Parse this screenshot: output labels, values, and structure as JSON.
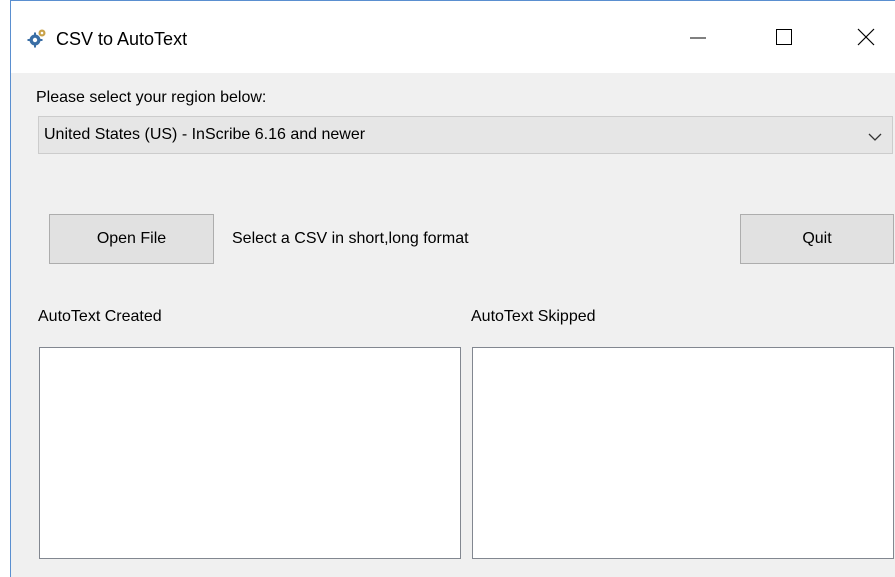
{
  "window": {
    "title": "CSV to AutoText",
    "icons": {
      "app": "gear-icon",
      "minimize": "minimize-icon",
      "maximize": "maximize-icon",
      "close": "close-icon"
    },
    "accent_border_color": "#5a8fd0"
  },
  "region": {
    "label": "Please select your region below:",
    "selected": "United States (US) - InScribe 6.16 and newer",
    "icon": "chevron-down-icon"
  },
  "actions": {
    "open_file_label": "Open File",
    "hint_text": "Select a CSV in short,long format",
    "quit_label": "Quit"
  },
  "lists": {
    "created_label": "AutoText Created",
    "skipped_label": "AutoText Skipped",
    "created_items": [],
    "skipped_items": []
  }
}
